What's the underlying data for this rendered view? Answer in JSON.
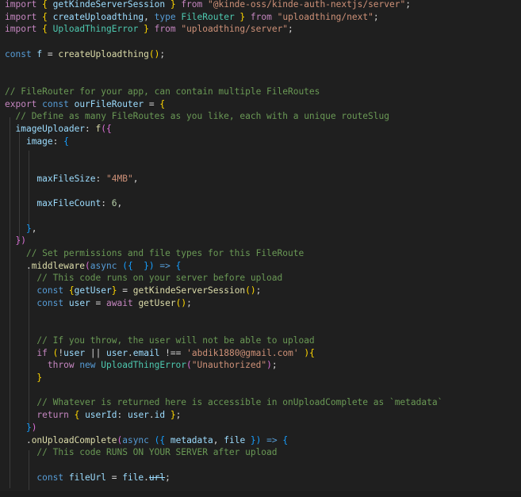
{
  "editor": {
    "lines": [
      [
        [
          "k",
          "import "
        ],
        [
          "b1",
          "{ "
        ],
        [
          "v",
          "getKindeServerSession"
        ],
        [
          "b1",
          " }"
        ],
        [
          "k",
          " from "
        ],
        [
          "st",
          "\"@kinde-oss/kinde-auth-nextjs/server\""
        ],
        [
          "p",
          ";"
        ]
      ],
      [
        [
          "k",
          "import "
        ],
        [
          "b1",
          "{ "
        ],
        [
          "v",
          "createUploadthing"
        ],
        [
          "p",
          ", "
        ],
        [
          "s",
          "type "
        ],
        [
          "t",
          "FileRouter"
        ],
        [
          "b1",
          " }"
        ],
        [
          "k",
          " from "
        ],
        [
          "st",
          "\"uploadthing/next\""
        ],
        [
          "p",
          ";"
        ]
      ],
      [
        [
          "k",
          "import "
        ],
        [
          "b1",
          "{ "
        ],
        [
          "t",
          "UploadThingError"
        ],
        [
          "b1",
          " }"
        ],
        [
          "k",
          " from "
        ],
        [
          "st",
          "\"uploadthing/server\""
        ],
        [
          "p",
          ";"
        ]
      ],
      [],
      [
        [
          "s",
          "const "
        ],
        [
          "v",
          "f"
        ],
        [
          "p",
          " = "
        ],
        [
          "f",
          "createUploadthing"
        ],
        [
          "b1",
          "()"
        ],
        [
          "p",
          ";"
        ]
      ],
      [],
      [],
      [
        [
          "c",
          "// FileRouter for your app, can contain multiple FileRoutes"
        ]
      ],
      [
        [
          "k",
          "export "
        ],
        [
          "s",
          "const "
        ],
        [
          "v",
          "ourFileRouter"
        ],
        [
          "p",
          " = "
        ],
        [
          "b1",
          "{"
        ]
      ],
      [
        [
          "p",
          "  "
        ],
        [
          "c",
          "// Define as many FileRoutes as you like, each with a unique routeSlug"
        ]
      ],
      [
        [
          "p",
          "  "
        ],
        [
          "v",
          "imageUploader"
        ],
        [
          "p",
          ": "
        ],
        [
          "f",
          "f"
        ],
        [
          "b2",
          "({"
        ]
      ],
      [
        [
          "p",
          "    "
        ],
        [
          "v",
          "image"
        ],
        [
          "p",
          ": "
        ],
        [
          "b3",
          "{"
        ]
      ],
      [],
      [],
      [
        [
          "p",
          "      "
        ],
        [
          "v",
          "maxFileSize"
        ],
        [
          "p",
          ": "
        ],
        [
          "st",
          "\"4MB\""
        ],
        [
          "p",
          ","
        ]
      ],
      [],
      [
        [
          "p",
          "      "
        ],
        [
          "v",
          "maxFileCount"
        ],
        [
          "p",
          ": "
        ],
        [
          "n",
          "6"
        ],
        [
          "p",
          ","
        ]
      ],
      [],
      [
        [
          "p",
          "    "
        ],
        [
          "b3",
          "}"
        ],
        [
          "p",
          ","
        ]
      ],
      [
        [
          "p",
          "  "
        ],
        [
          "b2",
          "})"
        ]
      ],
      [
        [
          "p",
          "    "
        ],
        [
          "c",
          "// Set permissions and file types for this FileRoute"
        ]
      ],
      [
        [
          "p",
          "    ."
        ],
        [
          "f",
          "middleware"
        ],
        [
          "b2",
          "("
        ],
        [
          "s",
          "async "
        ],
        [
          "b3",
          "({  })"
        ],
        [
          "s",
          " => "
        ],
        [
          "b3",
          "{"
        ]
      ],
      [
        [
          "p",
          "      "
        ],
        [
          "c",
          "// This code runs on your server before upload"
        ]
      ],
      [
        [
          "p",
          "      "
        ],
        [
          "s",
          "const "
        ],
        [
          "b1",
          "{"
        ],
        [
          "v",
          "getUser"
        ],
        [
          "b1",
          "}"
        ],
        [
          "p",
          " = "
        ],
        [
          "f",
          "getKindeServerSession"
        ],
        [
          "b1",
          "()"
        ],
        [
          "p",
          ";"
        ]
      ],
      [
        [
          "p",
          "      "
        ],
        [
          "s",
          "const "
        ],
        [
          "v",
          "user"
        ],
        [
          "p",
          " = "
        ],
        [
          "k",
          "await "
        ],
        [
          "f",
          "getUser"
        ],
        [
          "b1",
          "()"
        ],
        [
          "p",
          ";"
        ]
      ],
      [],
      [],
      [
        [
          "p",
          "      "
        ],
        [
          "c",
          "// If you throw, the user will not be able to upload"
        ]
      ],
      [
        [
          "p",
          "      "
        ],
        [
          "k",
          "if "
        ],
        [
          "b1",
          "("
        ],
        [
          "p",
          "!"
        ],
        [
          "v",
          "user"
        ],
        [
          "p",
          " || "
        ],
        [
          "v",
          "user"
        ],
        [
          "p",
          "."
        ],
        [
          "v",
          "email"
        ],
        [
          "p",
          " !== "
        ],
        [
          "st",
          "'abdik1880@gmail.com'"
        ],
        [
          "b1",
          " )"
        ],
        [
          "b1",
          "{"
        ]
      ],
      [
        [
          "p",
          "        "
        ],
        [
          "k",
          "throw "
        ],
        [
          "s",
          "new "
        ],
        [
          "t",
          "UploadThingError"
        ],
        [
          "b2",
          "("
        ],
        [
          "st",
          "\"Unauthorized\""
        ],
        [
          "b2",
          ")"
        ],
        [
          "p",
          ";"
        ]
      ],
      [
        [
          "p",
          "      "
        ],
        [
          "b1",
          "}"
        ]
      ],
      [],
      [
        [
          "p",
          "      "
        ],
        [
          "c",
          "// Whatever is returned here is accessible in onUploadComplete as `metadata`"
        ]
      ],
      [
        [
          "p",
          "      "
        ],
        [
          "k",
          "return "
        ],
        [
          "b1",
          "{ "
        ],
        [
          "v",
          "userId"
        ],
        [
          "p",
          ": "
        ],
        [
          "v",
          "user"
        ],
        [
          "p",
          "."
        ],
        [
          "v",
          "id"
        ],
        [
          "b1",
          " }"
        ],
        [
          "p",
          ";"
        ]
      ],
      [
        [
          "p",
          "    "
        ],
        [
          "b3",
          "}"
        ],
        [
          "b2",
          ")"
        ]
      ],
      [
        [
          "p",
          "    ."
        ],
        [
          "f",
          "onUploadComplete"
        ],
        [
          "b2",
          "("
        ],
        [
          "s",
          "async "
        ],
        [
          "b3",
          "({ "
        ],
        [
          "v",
          "metadata"
        ],
        [
          "p",
          ", "
        ],
        [
          "v",
          "file"
        ],
        [
          "b3",
          " })"
        ],
        [
          "s",
          " => "
        ],
        [
          "b3",
          "{"
        ]
      ],
      [
        [
          "p",
          "      "
        ],
        [
          "c",
          "// This code RUNS ON YOUR SERVER after upload"
        ]
      ],
      [],
      [
        [
          "p",
          "      "
        ],
        [
          "s",
          "const "
        ],
        [
          "v",
          "fileUrl"
        ],
        [
          "p",
          " = "
        ],
        [
          "v",
          "file"
        ],
        [
          "p",
          "."
        ],
        [
          "v strike",
          "url"
        ],
        [
          "p",
          ";"
        ]
      ]
    ]
  }
}
